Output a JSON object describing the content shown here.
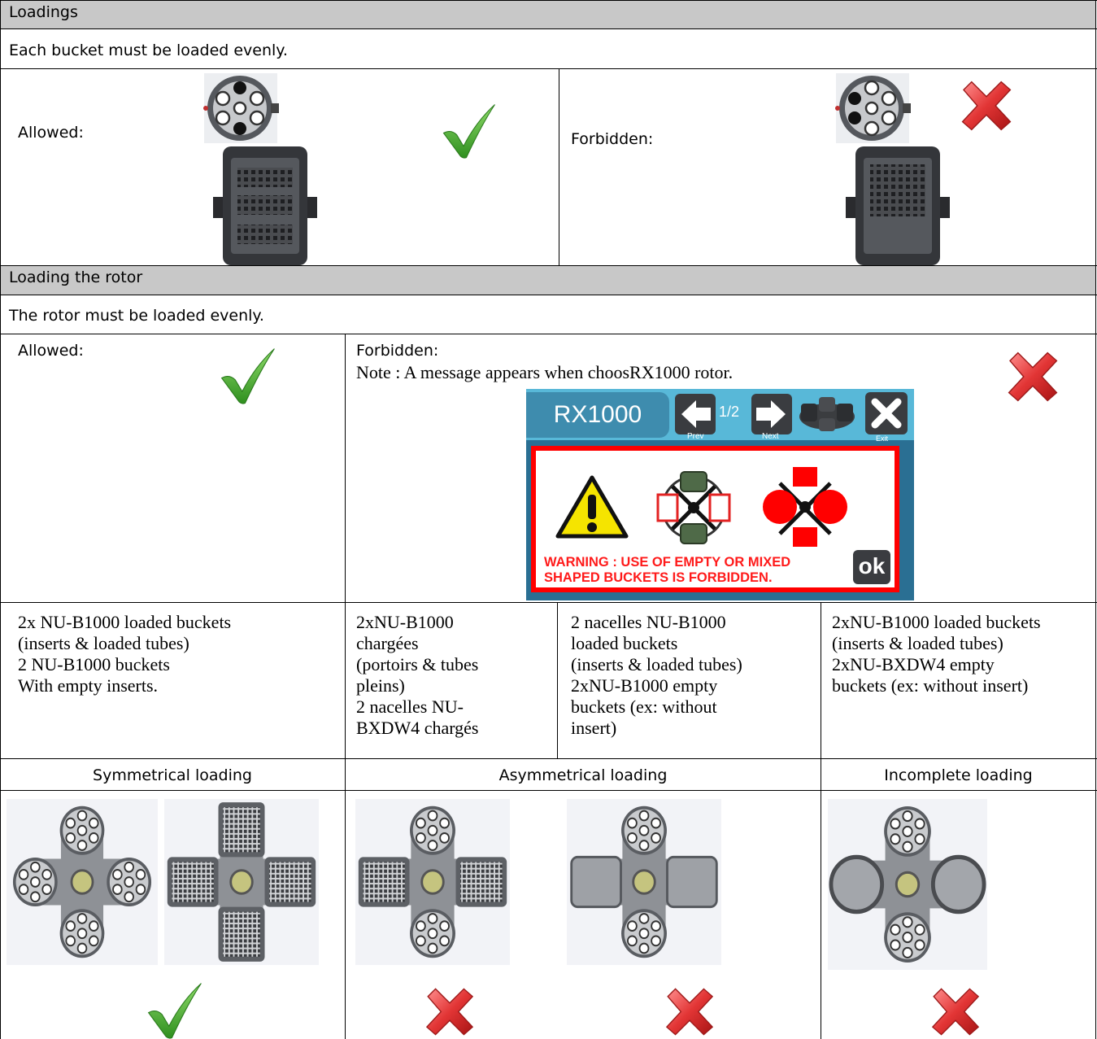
{
  "sections": {
    "loadings": {
      "title": "Loadings",
      "instruction": "Each bucket must be loaded evenly.",
      "allowed_label": "Allowed:",
      "forbidden_label": "Forbidden:"
    },
    "rotor": {
      "title": "Loading the rotor",
      "instruction": "The rotor must be loaded evenly.",
      "allowed_label": "Allowed:",
      "forbidden_label": "Forbidden:",
      "note": "Note : A message appears when choosRX1000 rotor."
    }
  },
  "dialog": {
    "title": "RX1000",
    "page": "1/2",
    "prev": "Prev",
    "next": "Next",
    "exit": "Exit",
    "warning_line1": "WARNING : USE OF EMPTY OR  MIXED",
    "warning_line2": "SHAPED BUCKETS IS FORBIDDEN.",
    "ok": "ok"
  },
  "descriptions": [
    [
      "2x NU-B1000 loaded buckets",
      "(inserts & loaded tubes)",
      "2 NU-B1000 buckets",
      "With empty inserts."
    ],
    [
      "2xNU-B1000",
      "chargées",
      "(portoirs & tubes",
      "pleins)",
      "2 nacelles NU-",
      "BXDW4 chargés"
    ],
    [
      "2 nacelles NU-B1000",
      "loaded buckets",
      "(inserts & loaded tubes)",
      "2xNU-B1000 empty",
      "buckets (ex: without",
      "insert)"
    ],
    [
      "2xNU-B1000 loaded buckets",
      "(inserts & loaded tubes)",
      "2xNU-BXDW4 empty",
      "buckets (ex: without insert)"
    ]
  ],
  "categories": {
    "symmetrical": "Symmetrical loading",
    "asymmetrical": "Asymmetrical loading",
    "incomplete": "Incomplete loading"
  },
  "icons": {
    "allowed": "check-mark-icon",
    "forbidden": "red-cross-icon",
    "warning": "warning-triangle-icon"
  },
  "colors": {
    "header_bg": "#c8c8c8",
    "check_green": "#3aa32a",
    "cross_red": "#d7262b",
    "dialog_blue": "#2e7fa3",
    "dialog_border": "#ff0000"
  }
}
